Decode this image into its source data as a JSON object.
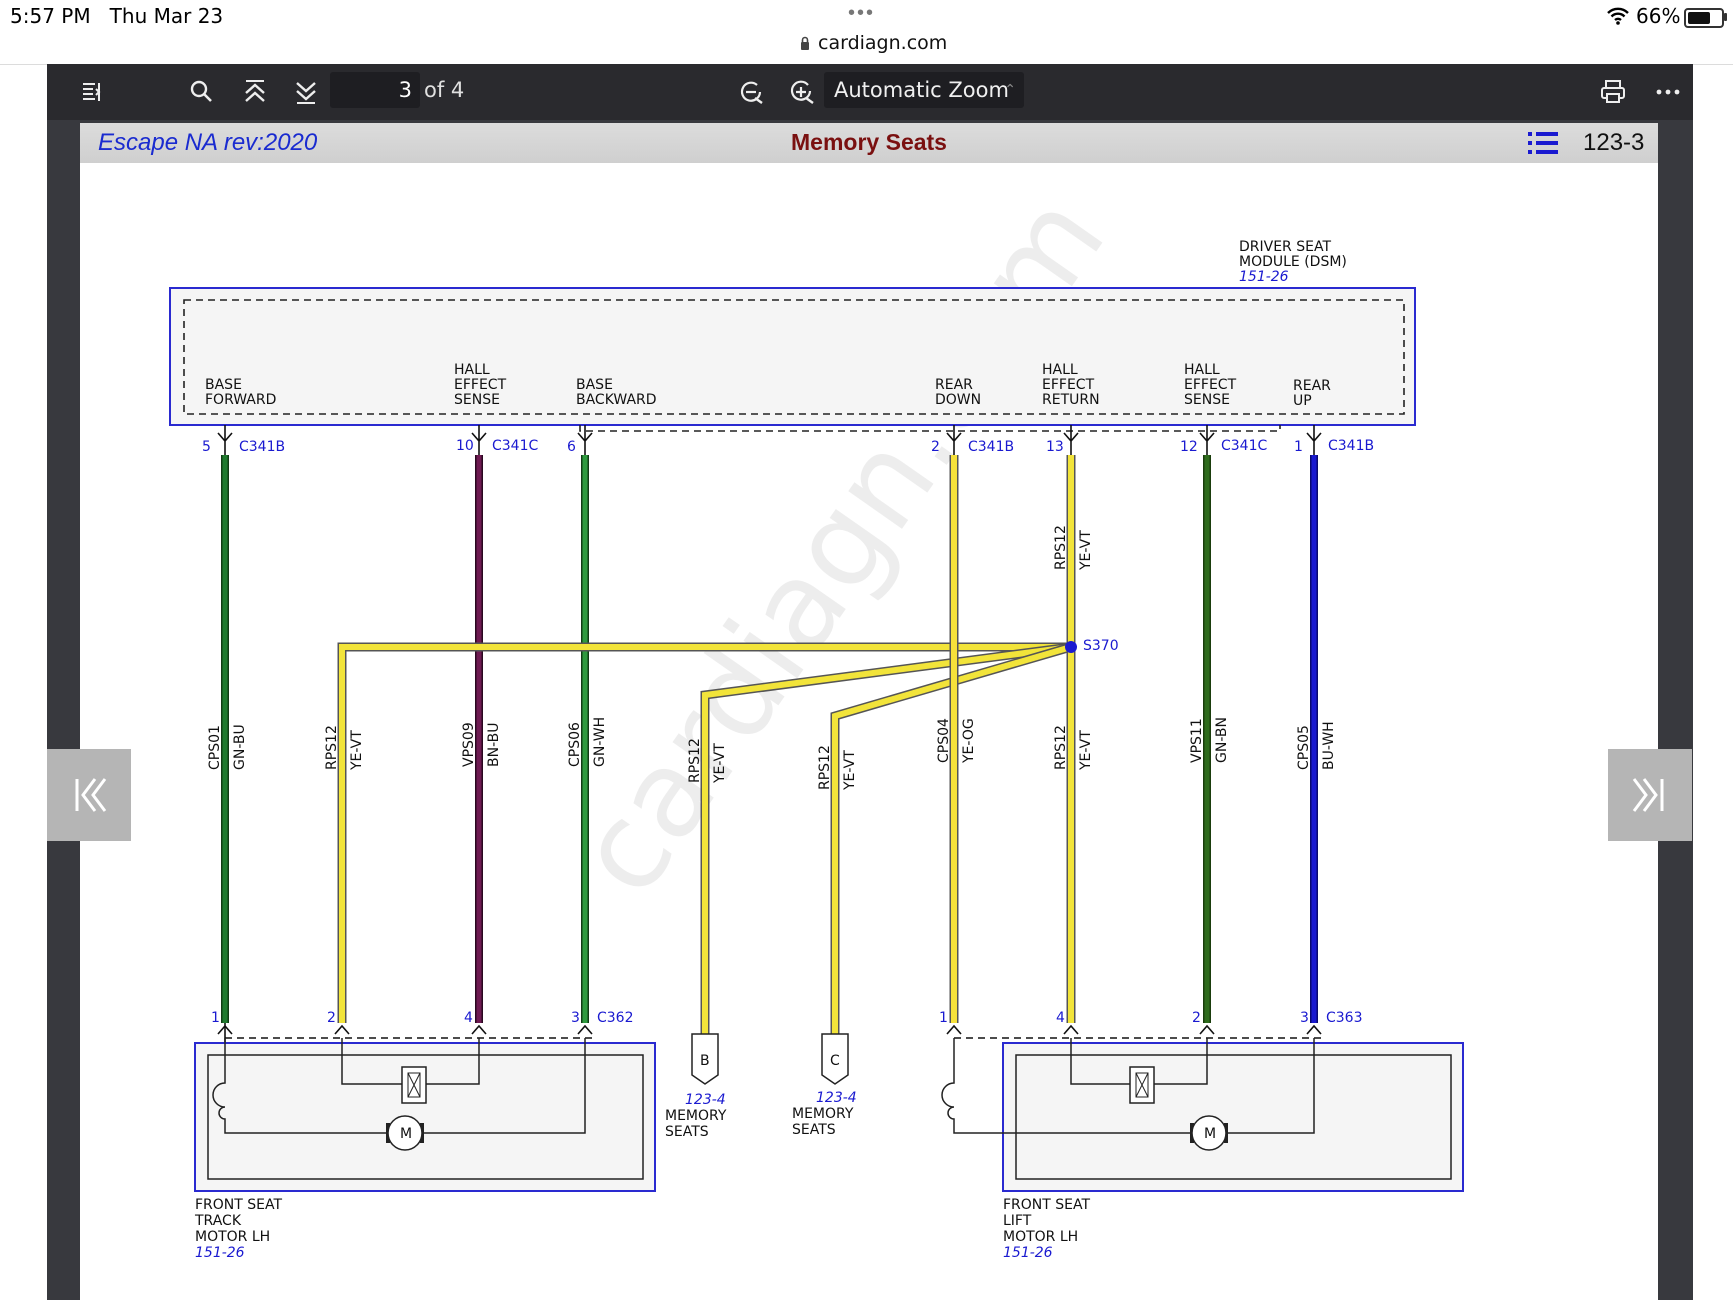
{
  "status_bar": {
    "time": "5:57 PM",
    "date": "Thu Mar 23",
    "url": "cardiagn.com",
    "battery": "66%"
  },
  "toolbar": {
    "page_number": "3",
    "page_total": "of 4",
    "zoom": "Automatic Zoom"
  },
  "header": {
    "model": "Escape NA rev:2020",
    "title": "Memory Seats",
    "page_ref": "123-3"
  },
  "watermark": "cardiagn.com",
  "module": {
    "name_line1": "DRIVER SEAT",
    "name_line2": "MODULE (DSM)",
    "ref": "151-26"
  },
  "pins": [
    {
      "label_lines": [
        "BASE",
        "FORWARD"
      ],
      "pin": "5",
      "connector": "C341B",
      "circuit": "CPS01",
      "color_code": "GN-BU"
    },
    {
      "label_lines": [
        "HALL",
        "EFFECT",
        "SENSE"
      ],
      "pin": "10",
      "connector": "C341C",
      "circuit": "VPS09",
      "color_code": "BN-BU"
    },
    {
      "label_lines": [
        "BASE",
        "BACKWARD"
      ],
      "pin": "6",
      "connector": "",
      "circuit": "CPS06",
      "color_code": "GN-WH"
    },
    {
      "label_lines": [
        "REAR",
        "DOWN"
      ],
      "pin": "2",
      "connector": "C341B",
      "circuit": "CPS04",
      "color_code": "YE-OG"
    },
    {
      "label_lines": [
        "HALL",
        "EFFECT",
        "RETURN"
      ],
      "pin": "13",
      "connector": "",
      "circuit": "RPS12",
      "color_code": "YE-VT"
    },
    {
      "label_lines": [
        "HALL",
        "EFFECT",
        "SENSE"
      ],
      "pin": "12",
      "connector": "C341C",
      "circuit": "VPS11",
      "color_code": "GN-BN"
    },
    {
      "label_lines": [
        "REAR",
        "UP"
      ],
      "pin": "1",
      "connector": "C341B",
      "circuit": "CPS05",
      "color_code": "BU-WH"
    }
  ],
  "splice": {
    "name": "S370",
    "branches": [
      {
        "circuit": "RPS12",
        "color_code": "YE-VT"
      },
      {
        "circuit": "RPS12",
        "color_code": "YE-VT"
      },
      {
        "circuit": "RPS12",
        "color_code": "YE-VT"
      },
      {
        "circuit": "RPS12",
        "color_code": "YE-VT"
      }
    ]
  },
  "motor_track": {
    "connector": "C362",
    "pins": [
      "1",
      "2",
      "4",
      "3"
    ],
    "name_lines": [
      "FRONT SEAT",
      "TRACK",
      "MOTOR LH"
    ],
    "ref": "151-26",
    "motor_label": "M"
  },
  "motor_lift": {
    "connector": "C363",
    "pins": [
      "1",
      "4",
      "2",
      "3"
    ],
    "name_lines": [
      "FRONT SEAT",
      "LIFT",
      "MOTOR LH"
    ],
    "ref": "151-26",
    "motor_label": "M"
  },
  "offpage": [
    {
      "letter": "B",
      "ref": "123-4",
      "name_lines": [
        "MEMORY",
        "SEATS"
      ]
    },
    {
      "letter": "C",
      "ref": "123-4",
      "name_lines": [
        "MEMORY",
        "SEATS"
      ]
    }
  ],
  "colors": {
    "green": "#1f7a2e",
    "dark_green": "#2e6b1c",
    "maroon": "#6e1a52",
    "yellow": "#f2e43a",
    "blue": "#1a1ad0",
    "title_red": "#7a1010",
    "module_outline": "#2a2ad0"
  }
}
